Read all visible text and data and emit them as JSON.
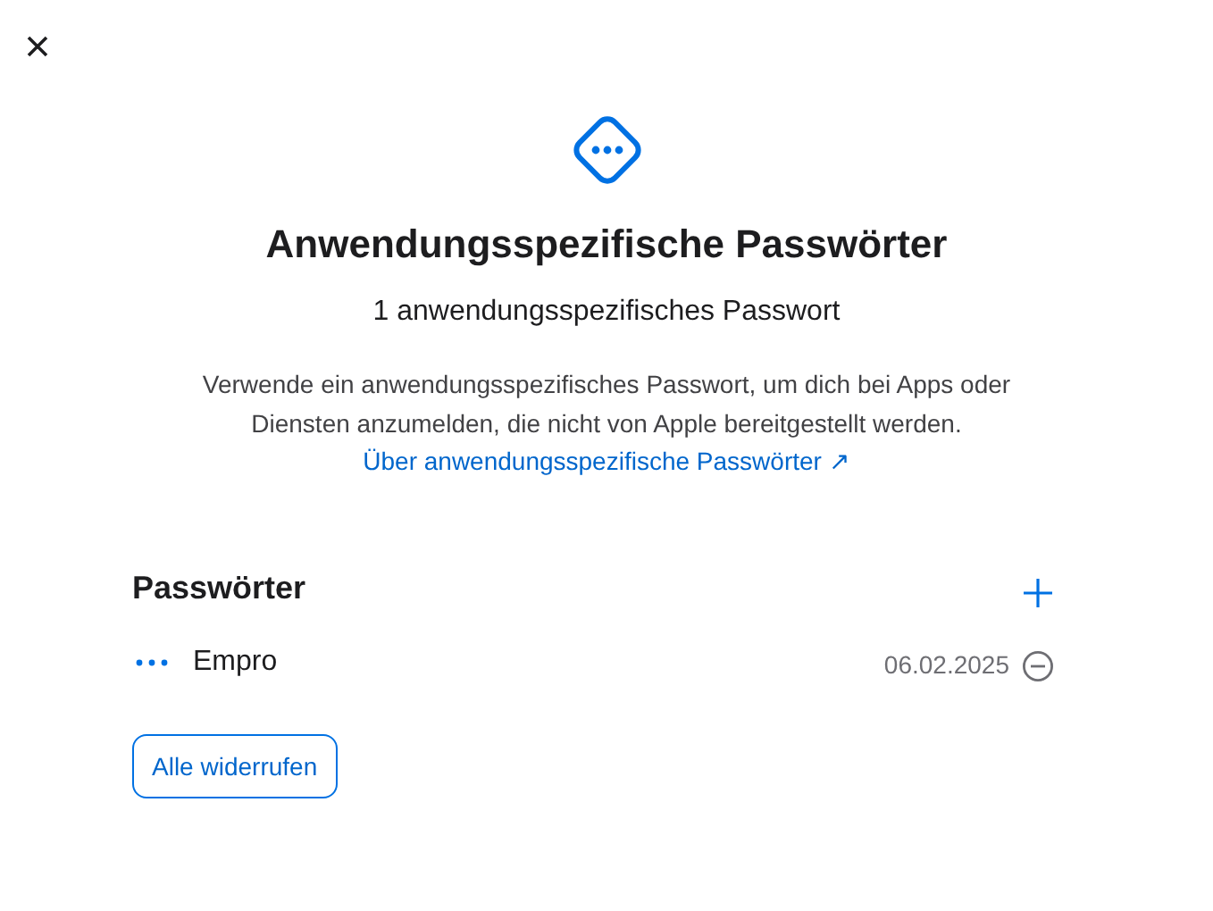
{
  "title": "Anwendungsspezifische Passwörter",
  "subtitle": "1 anwendungsspezifisches Passwort",
  "description": "Verwende ein anwendungsspezifisches Passwort, um dich bei Apps oder Diensten anzumelden, die nicht von Apple bereitgestellt werden.",
  "link": "Über anwendungsspezifische Passwörter ↗",
  "section_title": "Passwörter",
  "passwords": [
    {
      "name": "Empro",
      "date": "06.02.2025"
    }
  ],
  "revoke_button": "Alle widerrufen"
}
